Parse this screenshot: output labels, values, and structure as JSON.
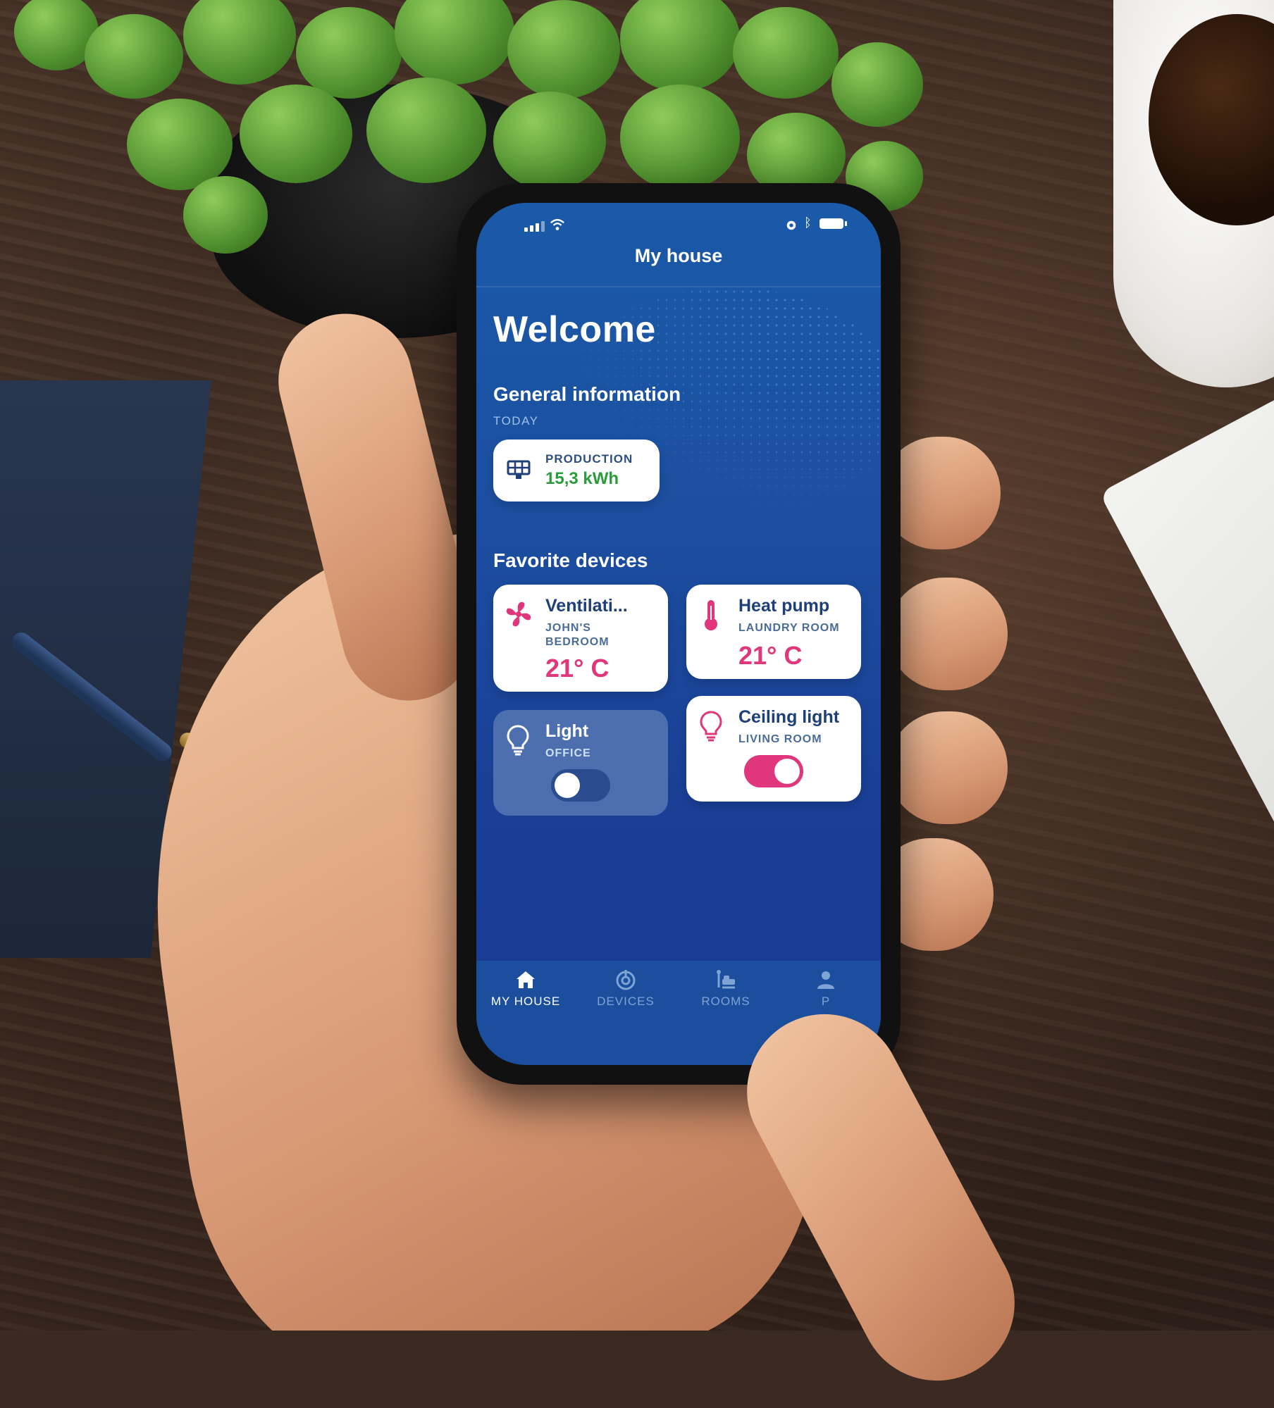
{
  "header": {
    "title": "My house"
  },
  "welcome": "Welcome",
  "general": {
    "title": "General information",
    "period": "TODAY",
    "production": {
      "label": "PRODUCTION",
      "value": "15,3 kWh"
    }
  },
  "favorites": {
    "title": "Favorite devices",
    "devices": [
      {
        "name": "Ventilati...",
        "room_line1": "JOHN'S",
        "room_line2": "BEDROOM",
        "temp": "21° C",
        "icon": "fan-icon"
      },
      {
        "name": "Heat pump",
        "room": "LAUNDRY ROOM",
        "temp": "21° C",
        "icon": "thermometer-icon"
      },
      {
        "name": "Light",
        "room": "OFFICE",
        "state": "off",
        "icon": "lightbulb-icon"
      },
      {
        "name": "Ceiling light",
        "room": "LIVING ROOM",
        "state": "on",
        "icon": "lightbulb-icon"
      }
    ]
  },
  "tabs": [
    {
      "label": "MY HOUSE",
      "icon": "home-icon",
      "active": true
    },
    {
      "label": "DEVICES",
      "icon": "devices-icon",
      "active": false
    },
    {
      "label": "ROOMS",
      "icon": "rooms-icon",
      "active": false
    },
    {
      "label": "P",
      "icon": "profile-icon",
      "active": false
    }
  ],
  "colors": {
    "accent_pink": "#e0367c",
    "production_green": "#2a9d3a",
    "screen_blue": "#1c4fa0"
  }
}
